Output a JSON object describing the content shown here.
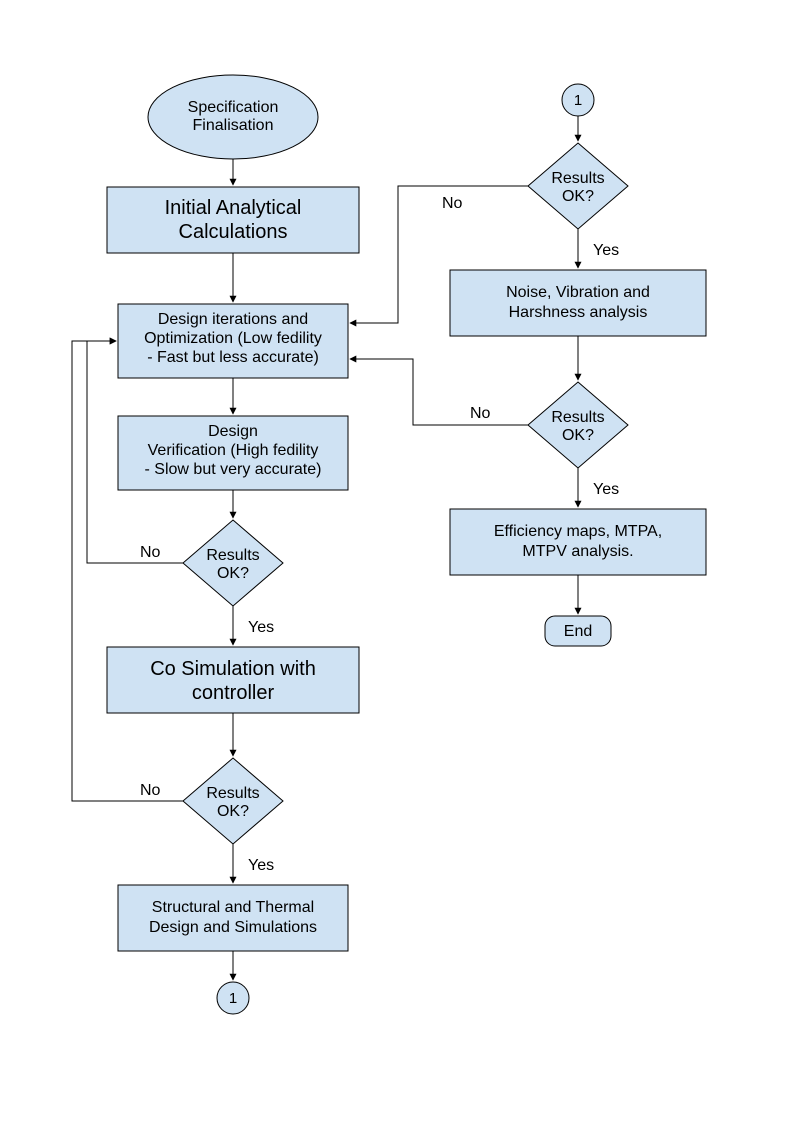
{
  "colors": {
    "shape_fill": "#cfe2f3",
    "stroke": "#000000"
  },
  "nodes": {
    "spec": {
      "line1": "Specification",
      "line2": "Finalisation"
    },
    "initial": {
      "line1": "Initial Analytical",
      "line2": "Calculations"
    },
    "iter": {
      "line1": "Design iterations and",
      "line2": "Optimization (Low fedility",
      "line3": "- Fast but less accurate)"
    },
    "verify": {
      "line1": "Design",
      "line2": "Verification (High fedility",
      "line3": "- Slow but very accurate)"
    },
    "dec1": {
      "line1": "Results",
      "line2": "OK?"
    },
    "cosim": {
      "line1": "Co Simulation with",
      "line2": "controller"
    },
    "dec2": {
      "line1": "Results",
      "line2": "OK?"
    },
    "struct": {
      "line1": "Structural and Thermal",
      "line2": "Design and Simulations"
    },
    "conn1": "1",
    "conn2": "1",
    "dec3": {
      "line1": "Results",
      "line2": "OK?"
    },
    "nvh": {
      "line1": "Noise, Vibration and",
      "line2": "Harshness analysis"
    },
    "dec4": {
      "line1": "Results",
      "line2": "OK?"
    },
    "eff": {
      "line1": "Efficiency maps, MTPA,",
      "line2": "MTPV analysis."
    },
    "end": "End"
  },
  "labels": {
    "no": "No",
    "yes": "Yes"
  }
}
